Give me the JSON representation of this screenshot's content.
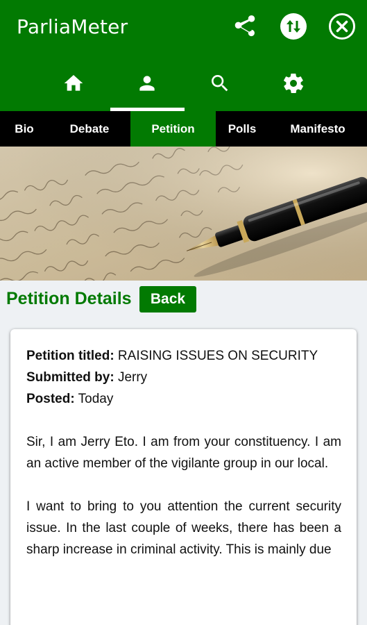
{
  "app": {
    "title": "ParliaMeter"
  },
  "top_actions": {
    "icons": [
      "share-icon",
      "swap-vertical-icon",
      "close-icon"
    ]
  },
  "bottom_nav": {
    "items": [
      "home-icon",
      "person-icon",
      "search-icon",
      "settings-icon"
    ],
    "active": "person-icon"
  },
  "tabs": {
    "items": [
      {
        "label": "Bio"
      },
      {
        "label": "Debate"
      },
      {
        "label": "Petition"
      },
      {
        "label": "Polls"
      },
      {
        "label": "Manifesto"
      }
    ],
    "active": "Petition"
  },
  "details": {
    "heading": "Petition Details",
    "back_label": "Back"
  },
  "petition": {
    "title_label": "Petition titled:",
    "title_value": " RAISING ISSUES ON SECURITY",
    "submitted_label": "Submitted by:",
    "submitted_value": " Jerry",
    "posted_label": "Posted:",
    "posted_value": " Today",
    "paragraphs": [
      "Sir, I am Jerry Eto. I am from your constituency. I am an active member of the vigilante group in our local.",
      "I want to bring to you attention the current security issue. In the last couple of weeks, there has been a sharp increase in criminal activity. This is mainly due"
    ]
  },
  "colors": {
    "primary": "#027a02",
    "tab_bar": "#000000",
    "background": "#eef1f4"
  }
}
